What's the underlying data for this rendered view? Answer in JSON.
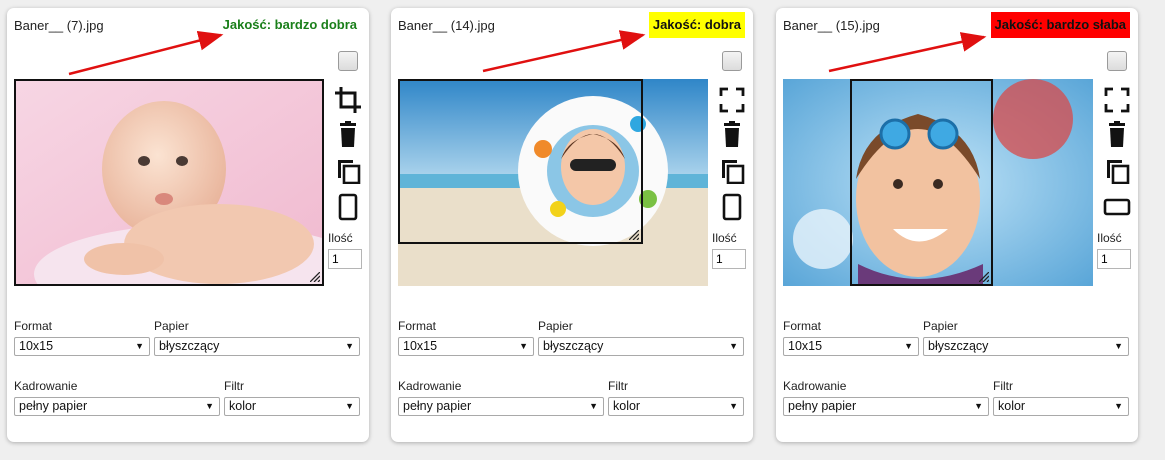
{
  "labels": {
    "qty": "Ilość",
    "format": "Format",
    "paper": "Papier",
    "crop": "Kadrowanie",
    "filter": "Filtr"
  },
  "colors": {
    "quality_good_text": "#1a7f1a",
    "quality_ok_bg": "#ffff00",
    "quality_bad_bg": "#ff0000",
    "arrow": "#e01010"
  },
  "cards": [
    {
      "filename": "Baner__ (7).jpg",
      "quality": "Jakość: bardzo dobra",
      "qty": "1",
      "format": "10x15",
      "paper": "błyszczący",
      "crop": "pełny papier",
      "filter": "kolor",
      "icons": [
        "crop-icon",
        "delete-icon",
        "copy-icon",
        "portrait-orientation-icon"
      ]
    },
    {
      "filename": "Baner__ (14).jpg",
      "quality": "Jakość: dobra",
      "qty": "1",
      "format": "10x15",
      "paper": "błyszczący",
      "crop": "pełny papier",
      "filter": "kolor",
      "icons": [
        "fullscreen-icon",
        "delete-icon",
        "copy-icon",
        "portrait-orientation-icon"
      ]
    },
    {
      "filename": "Baner__ (15).jpg",
      "quality": "Jakość: bardzo słaba",
      "qty": "1",
      "format": "10x15",
      "paper": "błyszczący",
      "crop": "pełny papier",
      "filter": "kolor",
      "icons": [
        "fullscreen-icon",
        "delete-icon",
        "copy-icon",
        "landscape-orientation-icon"
      ]
    }
  ]
}
